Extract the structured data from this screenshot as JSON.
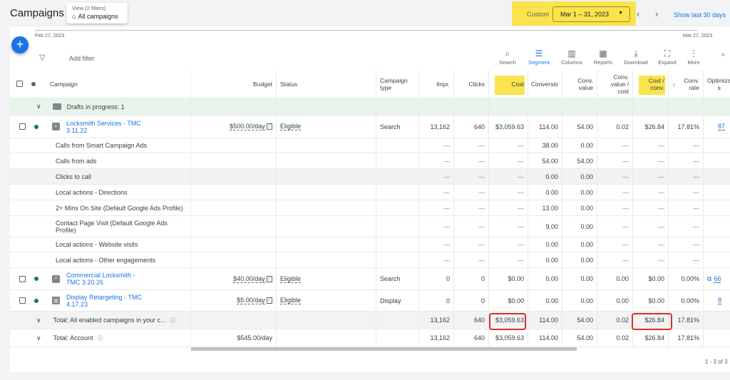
{
  "header": {
    "title": "Campaigns",
    "view_label": "View (2 filters)",
    "view_value": "All campaigns",
    "date_preset": "Custom",
    "date_range": "Mar 1 – 31, 2023",
    "show_last_30": "Show last 30 days"
  },
  "timeline": {
    "start": "Feb 27, 2023",
    "end": "Mar 27, 2023"
  },
  "toolbar": {
    "add_filter": "Add filter",
    "buttons": [
      {
        "label": "Search",
        "icon": "search-icon"
      },
      {
        "label": "Segment",
        "icon": "segment-icon"
      },
      {
        "label": "Columns",
        "icon": "columns-icon"
      },
      {
        "label": "Reports",
        "icon": "reports-icon"
      },
      {
        "label": "Download",
        "icon": "download-icon"
      },
      {
        "label": "Expand",
        "icon": "expand-icon"
      },
      {
        "label": "More",
        "icon": "more-icon"
      }
    ]
  },
  "columns": [
    "Campaign",
    "Budget",
    "Status",
    "Campaign type",
    "Impr.",
    "Clicks",
    "Cost",
    "Conversio",
    "Conv. value",
    "Conv. value / cost",
    "Cost / conv.",
    "Conv. rate",
    "Optimiza s"
  ],
  "highlighted_columns": [
    "Cost",
    "Cost / conv."
  ],
  "highlight_color": "#fbe34d",
  "drafts": "Drafts in progress: 1",
  "campaigns": [
    {
      "name": "Locksmith Services - TMC 3.11.22",
      "budget": "$500.00/day",
      "status": "Eligible",
      "type": "Search",
      "values": [
        "13,162",
        "640",
        "$3,059.63",
        "114.00",
        "54.00",
        "0.02",
        "$26.84",
        "17.81%"
      ],
      "opt": "87",
      "icon": "search-campaign-icon"
    },
    {
      "name": "Commercial Locksmith - TMC 3.20.26",
      "budget": "$40.00/day",
      "status": "Eligible",
      "type": "Search",
      "values": [
        "0",
        "0",
        "$0.00",
        "0.00",
        "0.00",
        "0.00",
        "$0.00",
        "0.00%"
      ],
      "opt": "66",
      "icon": "search-campaign-icon"
    },
    {
      "name": "Display Retargeting - TMC 4.17.23",
      "budget": "$5.00/day",
      "status": "Eligible",
      "type": "Display",
      "values": [
        "0",
        "0",
        "$0.00",
        "0.00",
        "0.00",
        "0.00",
        "$0.00",
        "0.00%"
      ],
      "opt": "8",
      "icon": "display-campaign-icon"
    }
  ],
  "segments": [
    {
      "name": "Calls from Smart Campaign Ads",
      "conv": "38.00",
      "value": "0.00"
    },
    {
      "name": "Calls from ads",
      "conv": "54.00",
      "value": "54.00"
    },
    {
      "name": "Clicks to call",
      "conv": "0.00",
      "value": "0.00"
    },
    {
      "name": "Local actions - Directions",
      "conv": "0.00",
      "value": "0.00"
    },
    {
      "name": "2+ Mins On Site (Default Google Ads Profile)",
      "conv": "13.00",
      "value": "0.00"
    },
    {
      "name": "Contact Page Visit (Default Google Ads Profile)",
      "conv": "9.00",
      "value": "0.00"
    },
    {
      "name": "Local actions - Website visits",
      "conv": "0.00",
      "value": "0.00"
    },
    {
      "name": "Local actions - Other engagements",
      "conv": "0.00",
      "value": "0.00"
    }
  ],
  "dash": "—",
  "totals": [
    {
      "label": "Total: All enabled campaigns in your c...",
      "budget": "",
      "values": [
        "13,162",
        "640",
        "$3,059.63",
        "114.00",
        "54.00",
        "0.02",
        "$26.84",
        "17.81%"
      ]
    },
    {
      "label": "Total: Account",
      "budget": "$545.00/day",
      "values": [
        "13,162",
        "640",
        "$3,059.63",
        "114.00",
        "54.00",
        "0.02",
        "$26.84",
        "17.81%"
      ]
    }
  ],
  "pager": "1 - 3 of 3",
  "status_color": "#188038"
}
